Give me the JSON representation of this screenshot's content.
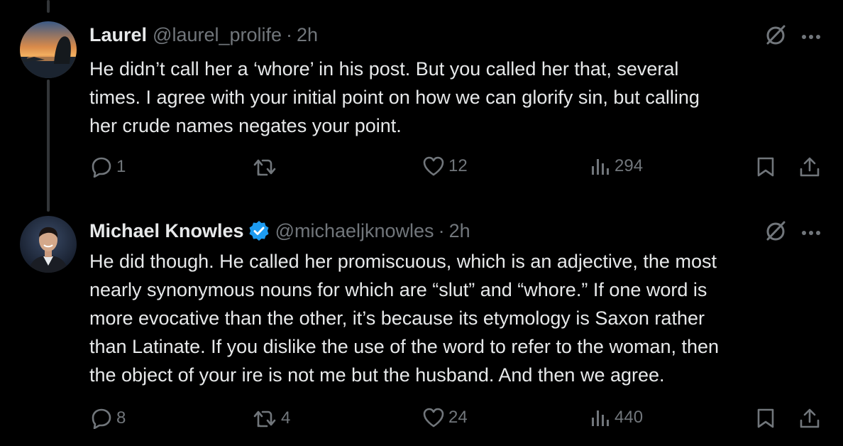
{
  "tweets": [
    {
      "name": "Laurel",
      "handle": "@laurel_prolife",
      "separator": "·",
      "time": "2h",
      "verified": false,
      "text": "He didn’t call her a ‘whore’ in his post. But you called her that, several\ntimes. I agree with your initial point on how we can glorify sin, but calling\nher crude names negates your point.",
      "replies": "1",
      "retweets": "",
      "likes": "12",
      "views": "294"
    },
    {
      "name": "Michael Knowles",
      "handle": "@michaeljknowles",
      "separator": "·",
      "time": "2h",
      "verified": true,
      "text": "He did though. He called her promiscuous, which is an adjective, the most\nnearly synonymous nouns for which are “slut” and “whore.” If one word is\nmore evocative than the other, it’s because its etymology is Saxon rather\nthan Latinate. If you dislike the use of the word to refer to the woman, then\nthe object of your ire is not me but the husband. And then we agree.",
      "replies": "8",
      "retweets": "4",
      "likes": "24",
      "views": "440"
    }
  ],
  "icons": {
    "reply": "reply-icon",
    "retweet": "retweet-icon",
    "like": "heart-icon",
    "views": "views-icon",
    "bookmark": "bookmark-icon",
    "share": "share-icon",
    "grok": "grok-icon",
    "more": "more-icon",
    "verified": "verified-badge-icon"
  },
  "colors": {
    "background": "#000000",
    "text": "#e7e9ea",
    "muted": "#71767b",
    "verified": "#1d9bf0",
    "thread_line": "#333639"
  }
}
